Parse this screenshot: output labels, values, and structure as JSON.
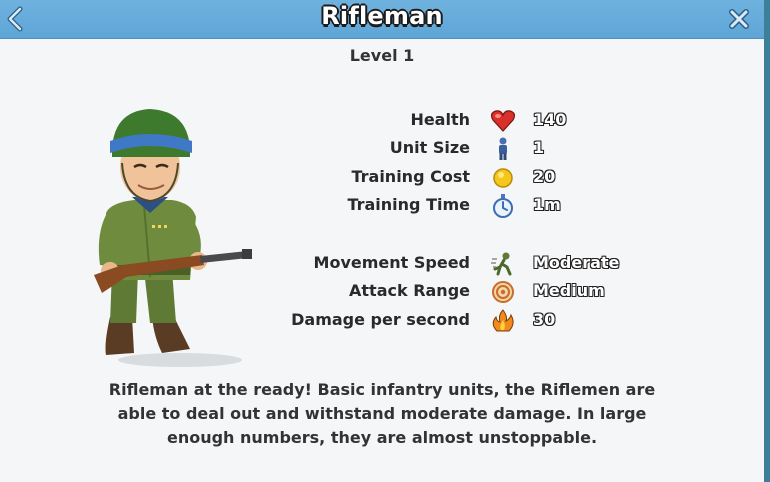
{
  "header": {
    "title": "Rifleman"
  },
  "level_label": "Level 1",
  "unit": {
    "portrait": "rifleman-soldier"
  },
  "stats": [
    {
      "label": "Health",
      "icon": "heart-icon",
      "value": "140"
    },
    {
      "label": "Unit Size",
      "icon": "soldier-figure-icon",
      "value": "1"
    },
    {
      "label": "Training Cost",
      "icon": "gold-coin-icon",
      "value": "20"
    },
    {
      "label": "Training Time",
      "icon": "stopwatch-icon",
      "value": "1m"
    },
    {
      "label": "Movement Speed",
      "icon": "running-soldier-icon",
      "value": "Moderate"
    },
    {
      "label": "Attack Range",
      "icon": "target-icon",
      "value": "Medium"
    },
    {
      "label": "Damage per second",
      "icon": "fire-icon",
      "value": "30"
    }
  ],
  "description": "Rifleman at the ready! Basic infantry units, the Riflemen are able to deal out and withstand moderate damage. In large enough numbers, they are almost unstoppable.",
  "colors": {
    "header": "#5ea5d6",
    "panel": "#f4f6f7",
    "frame": "#3b7f99"
  }
}
